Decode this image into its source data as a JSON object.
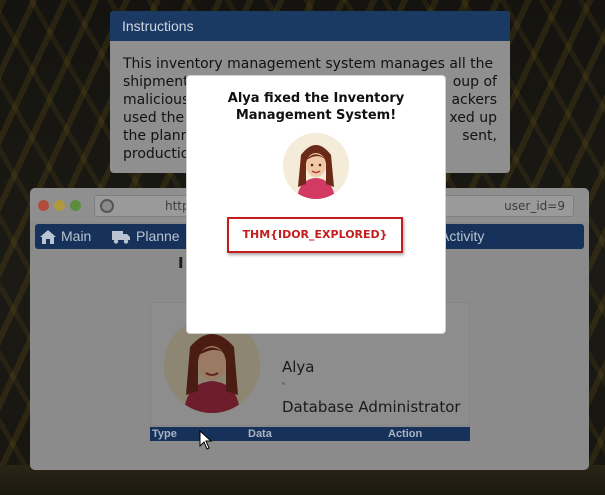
{
  "instructions": {
    "title": "Instructions",
    "lines": [
      "This inventory management system manages all the",
      "shipments",
      "oup of",
      "malicious",
      "ackers",
      "used the a",
      "xed up",
      "the planne",
      "sent,",
      "productio"
    ]
  },
  "browser": {
    "url_left": "http",
    "url_right": "user_id=9",
    "nav": {
      "main": "Main",
      "planned": "Planne",
      "activity": "Activity"
    },
    "page_heading": "I",
    "profile": {
      "name": "Alya",
      "role": "Database Administrator"
    },
    "table_headers": [
      "Type",
      "Data",
      "Action"
    ]
  },
  "modal": {
    "title_line1": "Alya fixed the Inventory",
    "title_line2": "Management System!",
    "flag": "THM{IDOR_EXPLORED}"
  },
  "colors": {
    "accent_blue": "#17325a",
    "flag_red": "#c41d1d"
  },
  "icons": {
    "home": "home-icon",
    "truck": "truck-icon",
    "cursor": "mouse-cursor-icon"
  }
}
